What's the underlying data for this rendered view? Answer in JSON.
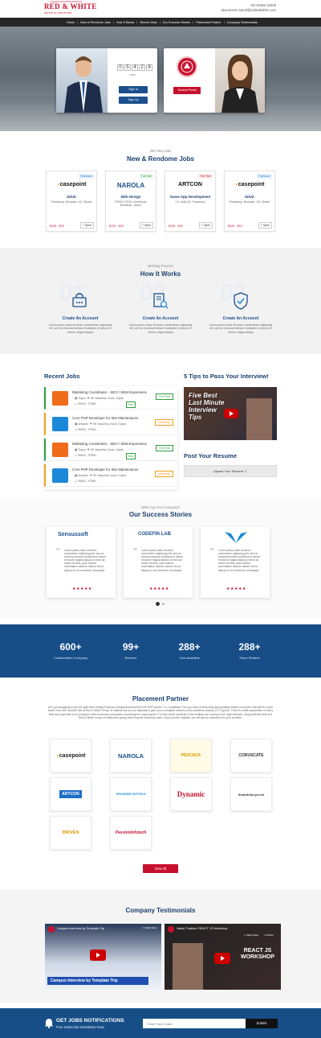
{
  "header": {
    "logo_tagline_top": "A LEADING EDUCATION INSTITUTE",
    "logo_text": "RED & WHITE",
    "logo_subtitle": "GROUP OF INSTITUTES",
    "phone": "+91 81553 22206",
    "email": "placement.manul@redandwhite.com"
  },
  "nav": [
    "Home",
    "New & Rendome Jobs",
    "How It Works",
    "Recent Jobs",
    "Our Success Stories",
    "Placement Partner",
    "Company Testimonials"
  ],
  "hero": {
    "counter": [
      "0",
      "5",
      "4",
      "2",
      "8"
    ],
    "counter_label": "JOBS",
    "sign_in": "Sign In",
    "sign_up": "Sign Up",
    "student_portal": "Student Portal"
  },
  "new_jobs": {
    "subtitle": "280 New Jobs",
    "title": "New & Rendome Jobs",
    "jobs": [
      {
        "tag": "Freelancer",
        "company": "casepoint",
        "title": "UI/UX",
        "skills": "Photoshop, Illustrator, XD, Sketch",
        "salary": "$12K - $1K",
        "openings": "7 Open"
      },
      {
        "tag": "Full Time",
        "company": "NAROLA",
        "title": "Web Design",
        "skills": "HTML5, CSS3, JavaScript, Bootstrap, Jquery",
        "salary": "$12K - $1K",
        "openings": "7 Open"
      },
      {
        "tag": "Part Time",
        "company": "ARTCON",
        "title": "Game App Development",
        "skills": "C#, Unity 3D, Photoshop",
        "salary": "$12K - $1K",
        "openings": "7 Open"
      },
      {
        "tag": "Freelancer",
        "company": "casepoint",
        "title": "UI/UX",
        "skills": "Photoshop, Illustrator, XD, Sketch",
        "salary": "$12K - $1K",
        "openings": "7 Open"
      }
    ]
  },
  "how": {
    "subtitle": "Working Process",
    "title": "How It Works",
    "steps": [
      {
        "num": "01",
        "title": "Create An Account",
        "text": "Lorem ipsum dolor sit amet, consectetur adipiscing elit, sed do eiusmod tempor incididunt ut labore et dolore magna aliqua"
      },
      {
        "num": "02",
        "title": "Create An Account",
        "text": "Lorem ipsum dolor sit amet, consectetur adipiscing elit, sed do eiusmod tempor incididunt ut labore et dolore magna aliqua"
      },
      {
        "num": "03",
        "title": "Create An Account",
        "text": "Lorem ipsum dolor sit amet, consectetur adipiscing elit, sed do eiusmod tempor incididunt ut labore et dolore magna aliqua"
      }
    ]
  },
  "recent": {
    "title": "Recent Jobs",
    "jobs": [
      {
        "title": "Marketing Coordinator - SEO / SEM Experience",
        "company": "Trigno",
        "location": "7th Varachha, Surat, Gujrat",
        "salary": "₹5000 - ₹7800",
        "badge": "Full Time",
        "badge_color": "#2e9d3e",
        "new": "New",
        "logo_color": "#ef6c1a"
      },
      {
        "title": "Core PHP Developer for Site Maintenance",
        "company": "Aviwarlo",
        "location": "7th Varachha, Surat, Gujrat",
        "salary": "₹5000 - ₹7800",
        "badge": "Internship",
        "badge_color": "#f0a020",
        "new": "",
        "logo_color": "#1e88d8"
      },
      {
        "title": "Marketing Coordinator - SEO / SEM Experience",
        "company": "Trigno",
        "location": "7th Varachha, Surat, Gujrat",
        "salary": "₹5000 - ₹7800",
        "badge": "Full Time",
        "badge_color": "#2e9d3e",
        "new": "New",
        "logo_color": "#ef6c1a"
      },
      {
        "title": "Core PHP Developer for Site Maintenance",
        "company": "Aviwarlo",
        "location": "7th Varachha, Surat, Gujrat",
        "salary": "₹5000 - ₹7800",
        "badge": "Internship",
        "badge_color": "#f0a020",
        "new": "",
        "logo_color": "#1e88d8"
      }
    ]
  },
  "tips": {
    "title": "5 Tips to Pass Your Interview!",
    "video_text_1": "Five Best",
    "video_text_2": "Last Minute",
    "video_text_3": "Interview",
    "video_text_4": "Tips"
  },
  "post_resume": {
    "title": "Post Your Resume",
    "button": "Upload Your Resume"
  },
  "success": {
    "subtitle": "What Say Our Company's",
    "title": "Our Success Stories",
    "stories": [
      {
        "company": "Sensussoft",
        "text": "Lorem ipsum dolor sit amet, consectetur adipiscing elit, sed do eiusmod tempor incididunt ut labore et dolore magna aliqua Ut enim ad minim veniam, quis nostrud exercitation ullamco laboris nisi ut aliquip ex ea commodo consequat.",
        "stars": "★★★★★"
      },
      {
        "company": "CODEFIN LAB",
        "text": "Lorem ipsum dolor sit amet, consectetur adipiscing elit, sed do eiusmod tempor incididunt ut labore et dolore magna aliqua Ut enim ad minim veniam, quis nostrud exercitation ullamco laboris nisi ut aliquip ex ea commodo consequat.",
        "stars": "★★★★★"
      },
      {
        "company": "",
        "text": "Lorem ipsum dolor sit amet, consectetur adipiscing elit, sed do eiusmod tempor incididunt ut labore et dolore magna aliqua Ut enim ad minim veniam, quis nostrud exercitation ullamco laboris nisi ut aliquip ex ea commodo consequat.",
        "stars": "★★★★★"
      }
    ]
  },
  "stats": [
    {
      "num": "600+",
      "label": "Collaboration Company"
    },
    {
      "num": "99+",
      "label": "Resume"
    },
    {
      "num": "288+",
      "label": "Jobs Available"
    },
    {
      "num": "288+",
      "label": "Place Student"
    }
  ],
  "partners": {
    "title": "Placement Partner",
    "text": "Are you struggling to get the right Web Design/Graphics Design/Android/iOS/Core PHP career? Or, Candidate? Are you tired of searching appropriately skilled resources that will fit in your team? No more worries! We at Red & White Group of Institute are at your disposal to give you a complete solution to the problems arising in IT Experts. There is a stiff competition in every field and corporate is no exception with numerous companies increasing at a rapid speed. For that, these students of the institute are moving in the right direction, along with the field and Red & White Group of Institutions giving them experts what they want. If you join the institute, you will get an assurance to your problem.",
    "logos": [
      {
        "name": "casepoint",
        "color": "#1b1b1b"
      },
      {
        "name": "NAROLA",
        "color": "#1b4f8e"
      },
      {
        "name": "PERCEDA",
        "color": "#d99b00"
      },
      {
        "name": "CORUSCATE",
        "color": "#333"
      },
      {
        "name": "ARTCON",
        "color": "#fff"
      },
      {
        "name": "GROWSEE SOFTECH",
        "color": "#1e88d8"
      },
      {
        "name": "Dynamic",
        "color": "#c8102e"
      },
      {
        "name": "SmartInfocys.net",
        "color": "#333"
      },
      {
        "name": "BRIVEN",
        "color": "#d99b00"
      },
      {
        "name": "PassionInfotech",
        "color": "#c8102e"
      }
    ],
    "view_all": "View All"
  },
  "testimonials": {
    "title": "Company Testimonials",
    "videos": [
      {
        "title": "Campus Interview by Template Trip",
        "caption": "Campus Interview by Template Trip"
      },
      {
        "title": "Vatsal Thakkar: REACT JS Workshop",
        "caption": "REACT JS WORKSHOP"
      }
    ],
    "watch_later": "Watch later",
    "share": "Share"
  },
  "newsletter": {
    "title": "GET JOBS NOTIFICATIONS",
    "subtitle": "Free Subscribe Newsletter Now!",
    "placeholder": "Enter Your Email",
    "button": "Submit"
  }
}
